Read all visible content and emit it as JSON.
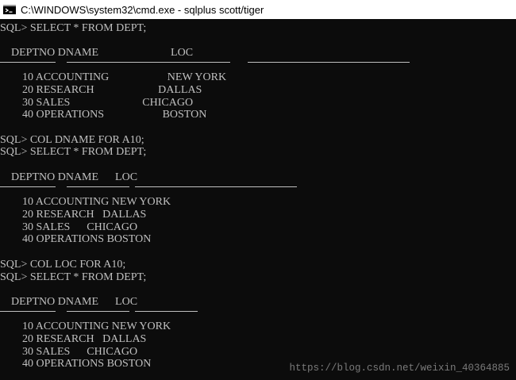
{
  "window": {
    "title": "C:\\WINDOWS\\system32\\cmd.exe - sqlplus  scott/tiger",
    "icon": "cmd-console-icon"
  },
  "console": {
    "lines": [
      "SQL> SELECT * FROM DEPT;",
      "",
      "    DEPTNO DNAME                          LOC",
      "",
      "        10 ACCOUNTING                     NEW YORK",
      "        20 RESEARCH                       DALLAS",
      "        30 SALES                          CHICAGO",
      "        40 OPERATIONS                     BOSTON",
      "",
      "SQL> COL DNAME FOR A10;",
      "SQL> SELECT * FROM DEPT;",
      "",
      "    DEPTNO DNAME      LOC",
      "",
      "        10 ACCOUNTING NEW YORK",
      "        20 RESEARCH   DALLAS",
      "        30 SALES      CHICAGO",
      "        40 OPERATIONS BOSTON",
      "",
      "SQL> COL LOC FOR A10;",
      "SQL> SELECT * FROM DEPT;",
      "",
      "    DEPTNO DNAME      LOC",
      "",
      "        10 ACCOUNTING NEW YORK",
      "        20 RESEARCH   DALLAS",
      "        30 SALES      CHICAGO",
      "        40 OPERATIONS BOSTON"
    ]
  },
  "watermark": "https://blog.csdn.net/weixin_40364885",
  "colors": {
    "background": "#0c0c0c",
    "text": "#c0c0c0",
    "titlebar": "#ffffff"
  }
}
